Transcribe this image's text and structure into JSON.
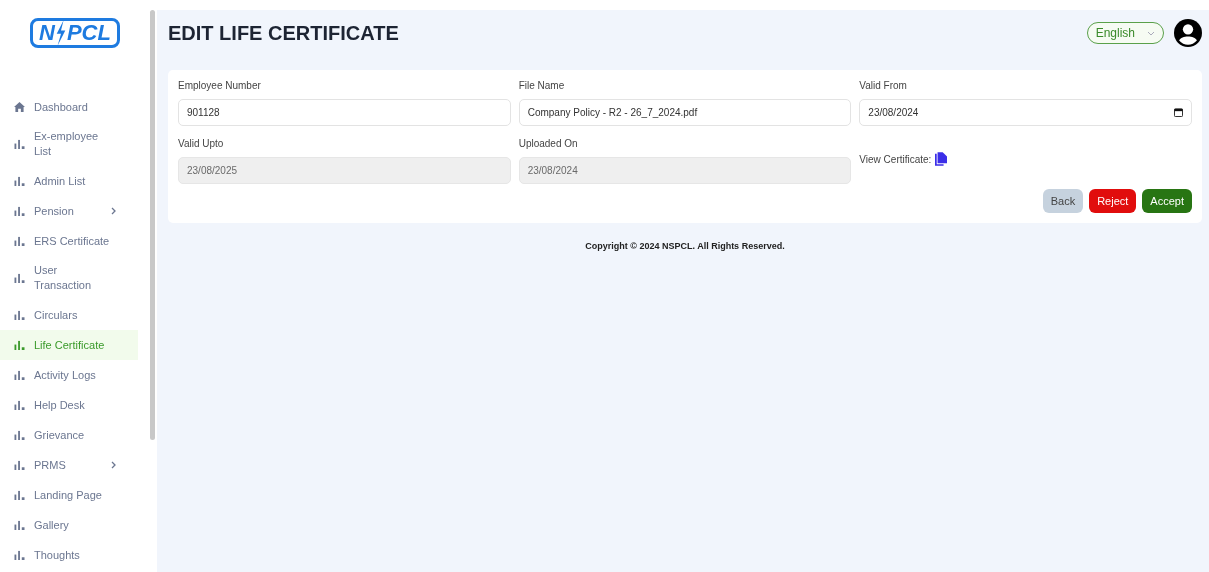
{
  "logo": {
    "left": "N",
    "right": "PCL"
  },
  "sidebar": {
    "items": [
      {
        "label": "Dashboard",
        "kind": "home",
        "selected": false,
        "submenu": false
      },
      {
        "label": "Ex-employee List",
        "kind": "bars",
        "selected": false,
        "submenu": false
      },
      {
        "label": "Admin List",
        "kind": "bars",
        "selected": false,
        "submenu": false
      },
      {
        "label": "Pension",
        "kind": "bars",
        "selected": false,
        "submenu": true
      },
      {
        "label": "ERS Certificate",
        "kind": "bars",
        "selected": false,
        "submenu": false
      },
      {
        "label": "User Transaction",
        "kind": "bars",
        "selected": false,
        "submenu": false
      },
      {
        "label": "Circulars",
        "kind": "bars",
        "selected": false,
        "submenu": false
      },
      {
        "label": "Life Certificate",
        "kind": "bars",
        "selected": true,
        "submenu": false
      },
      {
        "label": "Activity Logs",
        "kind": "bars",
        "selected": false,
        "submenu": false
      },
      {
        "label": "Help Desk",
        "kind": "bars",
        "selected": false,
        "submenu": false
      },
      {
        "label": "Grievance",
        "kind": "bars",
        "selected": false,
        "submenu": false
      },
      {
        "label": "PRMS",
        "kind": "bars",
        "selected": false,
        "submenu": true
      },
      {
        "label": "Landing Page",
        "kind": "bars",
        "selected": false,
        "submenu": false
      },
      {
        "label": "Gallery",
        "kind": "bars",
        "selected": false,
        "submenu": false
      },
      {
        "label": "Thoughts",
        "kind": "bars",
        "selected": false,
        "submenu": false
      }
    ]
  },
  "header": {
    "title": "EDIT LIFE CERTIFICATE",
    "language": "English"
  },
  "form": {
    "fields": [
      {
        "kind": "text",
        "label": "Employee Number",
        "value": "901128",
        "disabled": false
      },
      {
        "kind": "text",
        "label": "File Name",
        "value": "Company Policy - R2 - 26_7_2024.pdf",
        "disabled": false
      },
      {
        "kind": "date",
        "label": "Valid From",
        "value": "23/08/2024",
        "disabled": false
      },
      {
        "kind": "text",
        "label": "Valid Upto",
        "value": "23/08/2025",
        "disabled": true
      },
      {
        "kind": "text",
        "label": "Uploaded On",
        "value": "23/08/2024",
        "disabled": true
      },
      {
        "kind": "link",
        "label": "View Certificate:"
      }
    ],
    "buttons": [
      {
        "label": "Back",
        "kind": "back"
      },
      {
        "label": "Reject",
        "kind": "reject"
      },
      {
        "label": "Accept",
        "kind": "accept"
      }
    ]
  },
  "footer": "Copyright © 2024 NSPCL. All Rights Reserved."
}
